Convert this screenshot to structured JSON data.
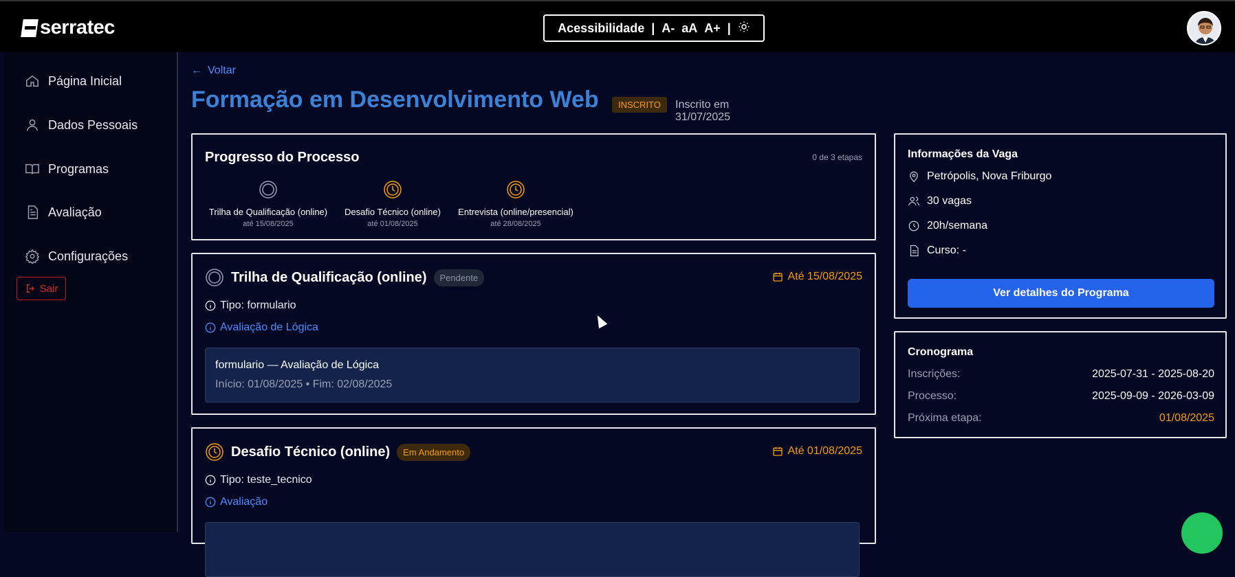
{
  "header": {
    "logo_text": "serratec",
    "accessibility_label": "Acessibilidade",
    "sep": "|",
    "font_decrease": "A-",
    "font_reset": "aA",
    "font_increase": "A+",
    "theme_icon": "sun-icon"
  },
  "sidebar": {
    "items": [
      {
        "label": "Página Inicial",
        "icon": "home-icon"
      },
      {
        "label": "Dados Pessoais",
        "icon": "user-icon"
      },
      {
        "label": "Programas",
        "icon": "book-icon"
      },
      {
        "label": "Avaliação",
        "icon": "document-icon"
      },
      {
        "label": "Configurações",
        "icon": "gear-icon"
      }
    ],
    "logout_label": "Sair"
  },
  "page": {
    "back_label": "Voltar",
    "title": "Formação em Desenvolvimento Web",
    "status_badge": "INSCRITO",
    "enrolled_text": "Inscrito em 31/07/2025"
  },
  "progress": {
    "title": "Progresso do Processo",
    "count_text": "0 de 3 etapas",
    "steps": [
      {
        "label": "Trilha de Qualificação (online)",
        "date": "até 15/08/2025",
        "state": "pending"
      },
      {
        "label": "Desafio Técnico (online)",
        "date": "até 01/08/2025",
        "state": "in-progress"
      },
      {
        "label": "Entrevista (online/presencial)",
        "date": "até 28/08/2025",
        "state": "in-progress"
      }
    ]
  },
  "stages": [
    {
      "title": "Trilha de Qualificação (online)",
      "status": "Pendente",
      "due": "Até 15/08/2025",
      "type": "Tipo: formulario",
      "link": "Avaliação de Lógica",
      "detail_title": "formulario — Avaliação de Lógica",
      "detail_dates": "Início: 01/08/2025 • Fim: 02/08/2025"
    },
    {
      "title": "Desafio Técnico (online)",
      "status": "Em Andamento",
      "due": "Até 01/08/2025",
      "type": "Tipo: teste_tecnico",
      "link": "Avaliação"
    }
  ],
  "vacancy": {
    "title": "Informações da Vaga",
    "location": "Petrópolis, Nova Friburgo",
    "slots": "30 vagas",
    "hours": "20h/semana",
    "course": "Curso: -",
    "button": "Ver detalhes do Programa"
  },
  "schedule": {
    "title": "Cronograma",
    "rows": [
      {
        "label": "Inscrições:",
        "value": "2025-07-31 - 2025-08-20"
      },
      {
        "label": "Processo:",
        "value": "2025-09-09 - 2026-03-09"
      },
      {
        "label": "Próxima etapa:",
        "value": "01/08/2025"
      }
    ]
  },
  "colors": {
    "accent": "#3b82d6",
    "warning": "#f59e0b",
    "button": "#2563eb",
    "danger": "#dc2626"
  }
}
